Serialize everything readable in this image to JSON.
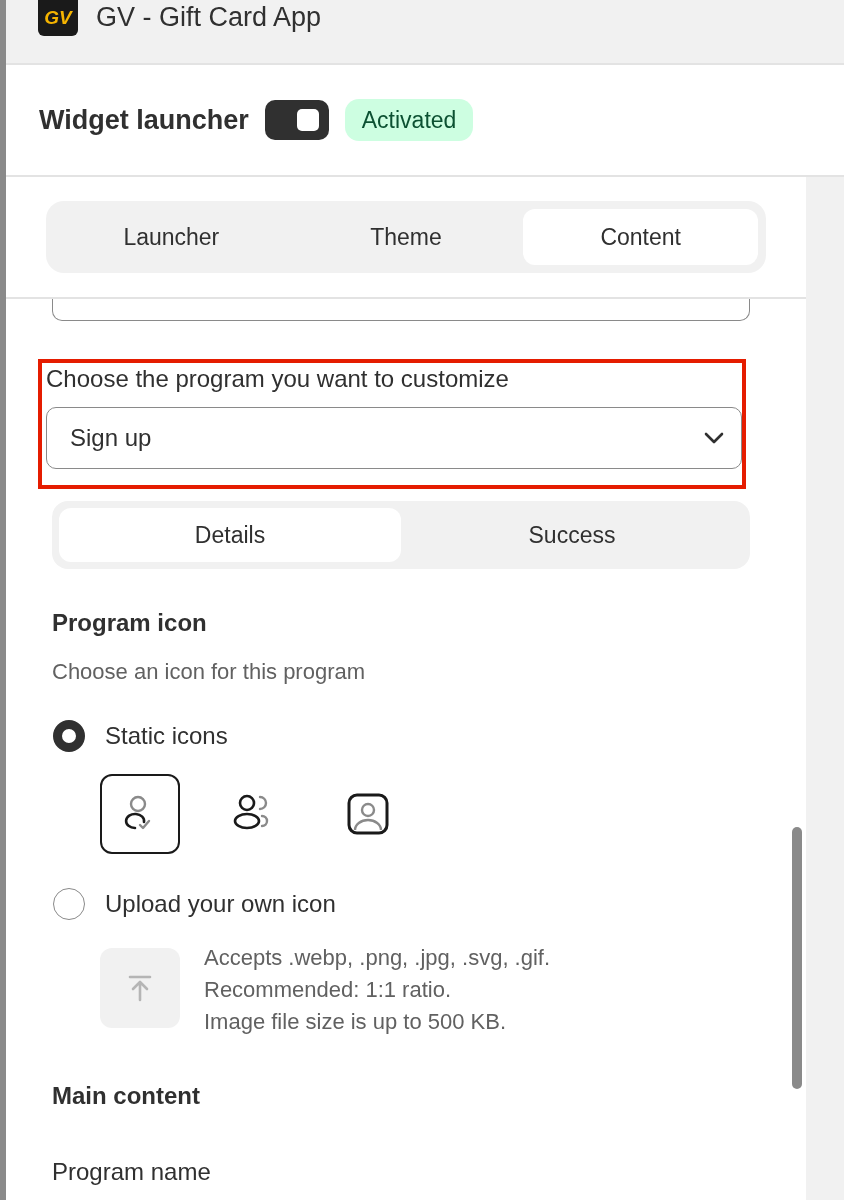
{
  "app": {
    "logo": "GV",
    "title": "GV - Gift Card App"
  },
  "launcher": {
    "label": "Widget launcher",
    "on": true,
    "badge": "Activated"
  },
  "tabs": [
    {
      "label": "Launcher",
      "selected": false
    },
    {
      "label": "Theme",
      "selected": false
    },
    {
      "label": "Content",
      "selected": true
    }
  ],
  "program_select": {
    "label": "Choose the program you want to customize",
    "value": "Sign up",
    "highlighted": true
  },
  "subtabs": [
    {
      "label": "Details",
      "selected": true
    },
    {
      "label": "Success",
      "selected": false
    }
  ],
  "program_icon": {
    "title": "Program icon",
    "hint": "Choose an icon for this program",
    "options": [
      {
        "kind": "static",
        "label": "Static icons",
        "selected": true,
        "icons": [
          {
            "kind": "person-check",
            "selected": true
          },
          {
            "kind": "people",
            "selected": false
          },
          {
            "kind": "person-square",
            "selected": false
          }
        ]
      },
      {
        "kind": "upload",
        "label": "Upload your own icon",
        "selected": false,
        "notes": [
          "Accepts .webp, .png, .jpg, .svg, .gif.",
          "Recommended: 1:1 ratio.",
          "Image file size is up to 500 KB."
        ]
      }
    ]
  },
  "main_content": {
    "title": "Main content",
    "fields": [
      {
        "label": "Program name"
      }
    ]
  }
}
